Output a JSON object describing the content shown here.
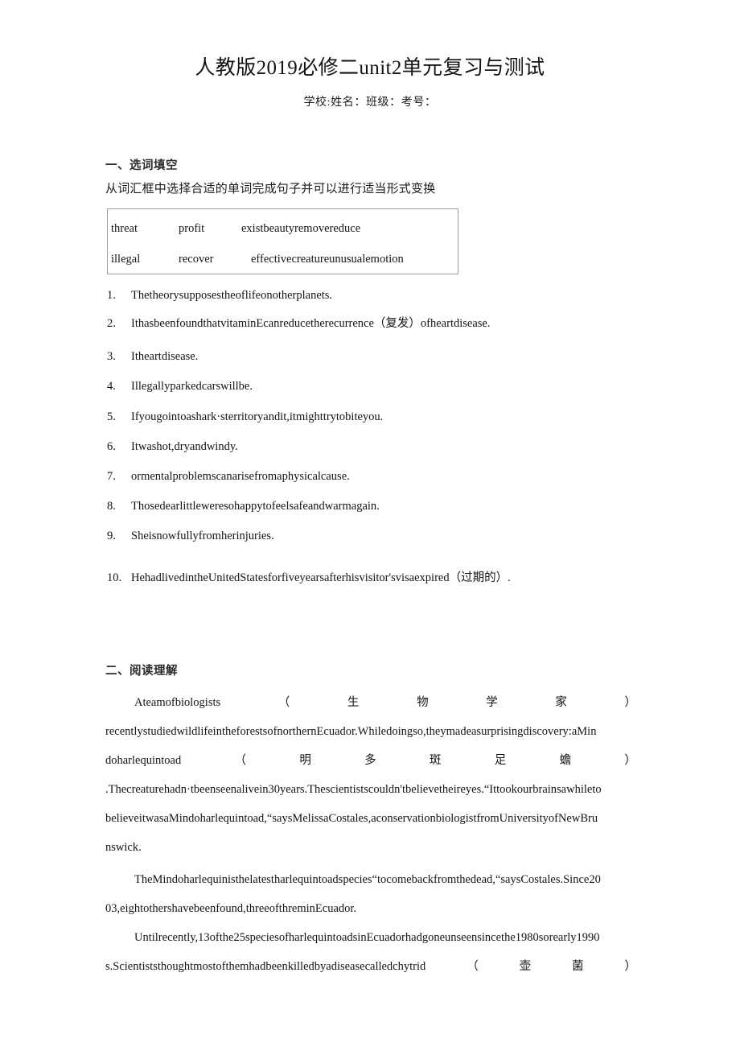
{
  "document": {
    "title": "人教版2019必修二unit2单元复习与测试",
    "subtitle": "学校:姓名：班级：考号："
  },
  "section_one": {
    "heading": "一、选词填空",
    "instruction": "从词汇框中选择合适的单词完成句子并可以进行适当形式变换",
    "word_bank": {
      "row1": {
        "a": "threat",
        "b": "profit",
        "c": "existbeautyremovereduce"
      },
      "row2": {
        "a": "illegal",
        "b": "recover",
        "c": "effectivecreatureunusualemotion"
      }
    },
    "items": [
      {
        "number": "1.",
        "text": "Thetheorysupposestheoflifeonotherplanets."
      },
      {
        "number": "2.",
        "text": "IthasbeenfoundthatvitaminEcanreducetherecurrence（复发）ofheartdisease."
      },
      {
        "number": "3.",
        "text": "Itheartdisease."
      },
      {
        "number": "4.",
        "text": "Illegallyparkedcarswillbe."
      },
      {
        "number": "5.",
        "text": "Ifyougointoashark·sterritoryandit,itmighttrytobiteyou."
      },
      {
        "number": "6.",
        "text": "Itwashot,dryandwindy."
      },
      {
        "number": "7.",
        "text": "ormentalproblemscanarisefromaphysicalcause."
      },
      {
        "number": "8.",
        "text": "Thosedearlittleweresohappytofeelsafeandwarmagain."
      },
      {
        "number": "9.",
        "text": "Sheisnowfullyfromherinjuries."
      },
      {
        "number": "10.",
        "text": "HehadlivedintheUnitedStatesforfiveyearsafterhisvisitor'svisaexpired（过期的）."
      }
    ]
  },
  "section_two": {
    "heading": "二、阅读理解",
    "paragraph1": {
      "line1_text": "Ateamofbiologists",
      "line1_paren_open": "（",
      "line1_paren_chars": [
        "生",
        "物",
        "学",
        "家"
      ],
      "line1_paren_close": "）",
      "line2": "recentlystudiedwildlifeintheforestsofnorthernEcuador.Whiledoingso,theymadeasurprisingdiscovery:aMin",
      "line3_text": "doharlequintoad",
      "line3_paren_open": "（",
      "line3_paren_chars": [
        "明",
        "多",
        "斑",
        "足",
        "蟾"
      ],
      "line3_paren_close": "）",
      "line4": ".Thecreaturehadn·tbeenseenalivein30years.Thescientistscouldn'tbelievetheireyes.“Ittookourbrainsawhileto",
      "line5": "believeitwasaMindoharlequintoad,“saysMelissaCostales,aconservationbiologistfromUniversityofNewBru",
      "line6": "nswick."
    },
    "paragraph2": {
      "line1": "TheMindoharlequinisthelatestharlequintoadspecies“tocomebackfromthedead,“saysCostales.Since20",
      "line2": "03,eightothershavebeenfound,threeofthreminEcuador."
    },
    "paragraph3": {
      "line1": "Untilrecently,13ofthe25speciesofharlequintoadsinEcuadorhadgoneunseensincethe1980sorearly1990",
      "line2_text": "s.Scientiststhoughtmostofthemhadbeenkilledbyadiseasecalledchytrid",
      "line2_paren_open": "（",
      "line2_paren_chars": [
        "壶",
        "菌"
      ],
      "line2_paren_close": "）"
    }
  }
}
